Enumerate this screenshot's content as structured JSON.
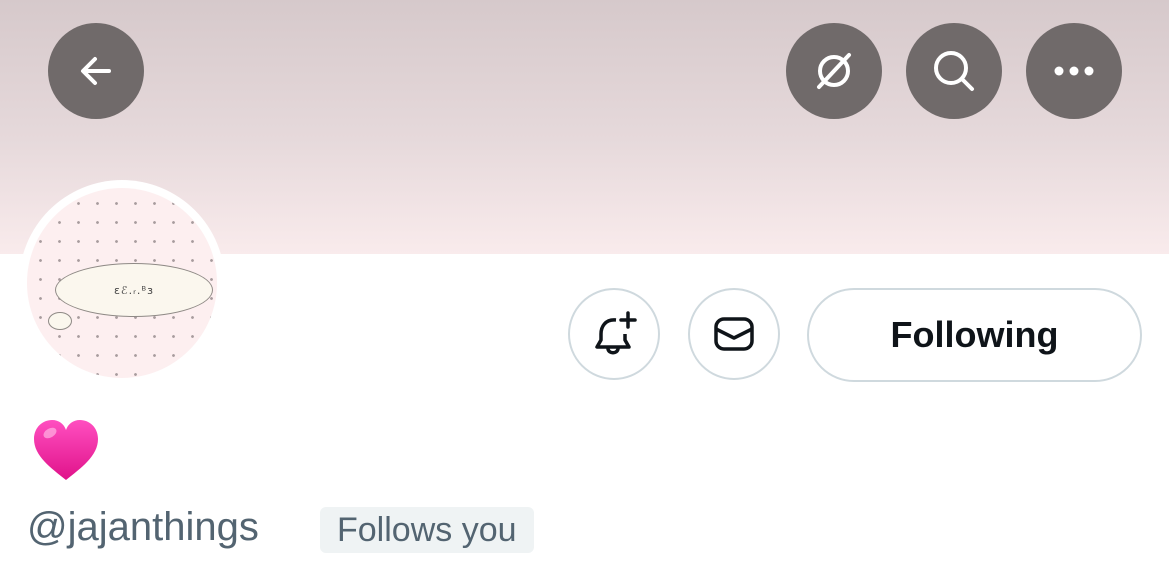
{
  "header": {
    "back_icon": "arrow-left-icon",
    "grok_icon": "grok-slash-icon",
    "search_icon": "search-icon",
    "more_icon": "more-horizontal-icon"
  },
  "avatar": {
    "bubble_text": "ɛℰ.ᵣ.ᴮɜ"
  },
  "actions": {
    "notify_icon": "bell-plus-icon",
    "message_icon": "envelope-icon",
    "following_label": "Following"
  },
  "profile": {
    "display_name_emoji": "heart-emoji",
    "handle": "@jajanthings",
    "follows_you_label": "Follows you"
  },
  "colors": {
    "header_button_bg": "#706a6a",
    "banner_top": "#d6c9cb",
    "banner_bottom": "#f9ebec",
    "handle_text": "#536471",
    "heart": "#f21fa1",
    "button_border": "#cfd9de"
  }
}
